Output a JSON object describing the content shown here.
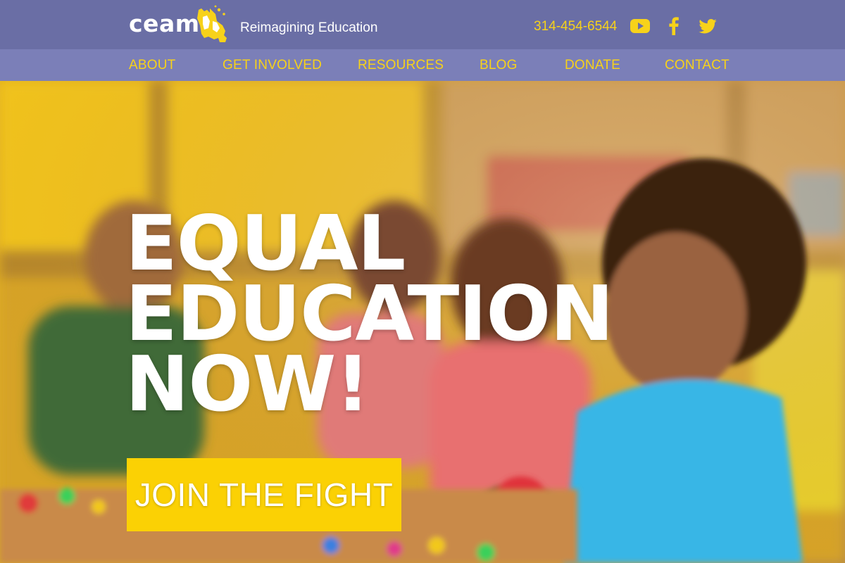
{
  "header": {
    "logo_text": "ceam",
    "tagline": "Reimagining Education",
    "phone": "314-454-6544",
    "social": [
      {
        "name": "youtube-icon"
      },
      {
        "name": "facebook-icon"
      },
      {
        "name": "twitter-icon"
      }
    ]
  },
  "nav": {
    "items": [
      {
        "label": "ABOUT"
      },
      {
        "label": "GET INVOLVED"
      },
      {
        "label": "RESOURCES"
      },
      {
        "label": "BLOG"
      },
      {
        "label": "DONATE"
      },
      {
        "label": "CONTACT"
      }
    ]
  },
  "hero": {
    "title_lines": [
      "EQUAL",
      "EDUCATION",
      "NOW!"
    ],
    "cta_label": "JOIN THE FIGHT"
  },
  "colors": {
    "header_bg": "#6a6ea5",
    "nav_bg": "#7b7fb8",
    "accent_yellow": "#f7d21a",
    "cta_bg": "#fbd104"
  }
}
